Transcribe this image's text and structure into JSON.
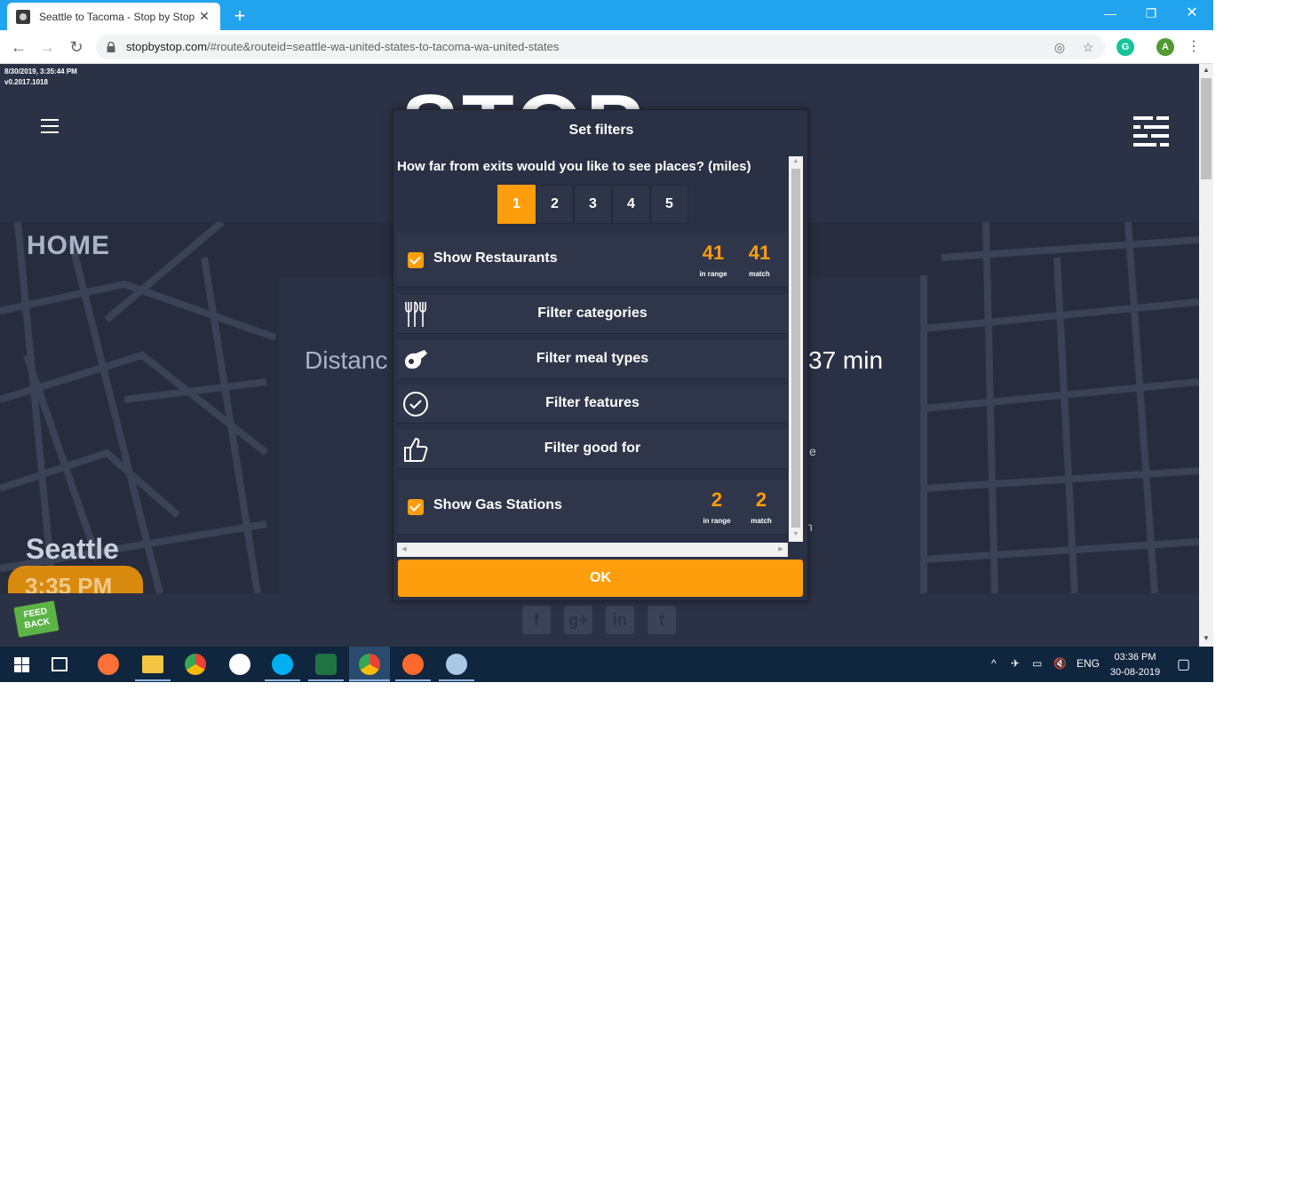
{
  "browser": {
    "tab_title": "Seattle to Tacoma - Stop by Stop",
    "url_host": "stopbystop.com",
    "url_rest": "/#route&routeid=seattle-wa-united-states-to-tacoma-wa-united-states",
    "profile_initial": "A",
    "extension_initial": "G"
  },
  "page": {
    "timestamp": "8/30/2019, 3:35:44 PM",
    "version": "v0.2017.1018",
    "logo_text": "STOP",
    "home_label": "HOME",
    "distance_label": "Distanc",
    "duration_text": "37 min",
    "fragment_e": "e",
    "fragment_n": "n",
    "origin_city": "Seattle",
    "origin_time": "3:35 PM",
    "feedback_label": "FEED BACK"
  },
  "dialog": {
    "title": "Set filters",
    "question": "How far from exits would you like to see places? (miles)",
    "miles": [
      "1",
      "2",
      "3",
      "4",
      "5"
    ],
    "selected_mile": "1",
    "restaurants": {
      "label": "Show Restaurants",
      "checked": true,
      "in_range": "41",
      "in_range_label": "in range",
      "match": "41",
      "match_label": "match"
    },
    "filters": [
      {
        "label": "Filter categories",
        "icon": "fork-knife-icon"
      },
      {
        "label": "Filter meal types",
        "icon": "meat-icon"
      },
      {
        "label": "Filter features",
        "icon": "check-circle-icon"
      },
      {
        "label": "Filter good for",
        "icon": "thumbs-up-icon"
      }
    ],
    "gas": {
      "label": "Show Gas Stations",
      "checked": true,
      "in_range": "2",
      "in_range_label": "in range",
      "match": "2",
      "match_label": "match"
    },
    "ok_label": "OK"
  },
  "social": [
    "facebook-icon",
    "google-plus-icon",
    "linkedin-icon",
    "twitter-icon"
  ],
  "taskbar": {
    "language": "ENG",
    "time": "03:36 PM",
    "date": "30-08-2019"
  },
  "colors": {
    "accent": "#ff9e0d",
    "page_bg": "#2c3245",
    "chrome_blue": "#22a3ee",
    "taskbar": "#10263f"
  }
}
